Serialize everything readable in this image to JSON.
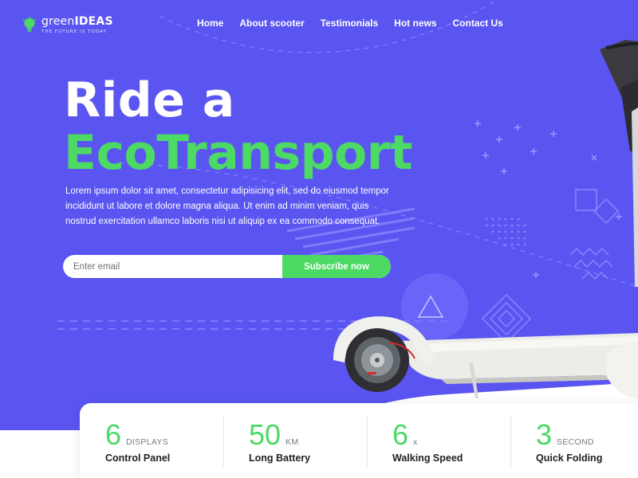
{
  "brand": {
    "name_part1": "green",
    "name_part2": "IDEAS",
    "tagline": "THE FUTURE IS TODAY"
  },
  "nav": {
    "items": [
      {
        "label": "Home"
      },
      {
        "label": "About scooter"
      },
      {
        "label": "Testimonials"
      },
      {
        "label": "Hot news"
      },
      {
        "label": "Contact Us"
      }
    ]
  },
  "hero": {
    "title_line1": "Ride a",
    "title_line2": "EcoTransport",
    "lead": "Lorem ipsum dolor sit amet, consectetur adipisicing elit, sed do eiusmod tempor incididunt ut labore et dolore magna aliqua. Ut enim ad minim veniam, quis nostrud exercitation ullamco laboris nisi ut aliquip ex ea commodo consequat."
  },
  "subscribe": {
    "placeholder": "Enter email",
    "button_label": "Subscribe now"
  },
  "stats": [
    {
      "value": "6",
      "unit": "DISPLAYS",
      "label": "Control Panel"
    },
    {
      "value": "50",
      "unit": "KM",
      "label": "Long Battery"
    },
    {
      "value": "6",
      "unit": "X",
      "label": "Walking Speed"
    },
    {
      "value": "3",
      "unit": "SECOND",
      "label": "Quick Folding"
    }
  ],
  "colors": {
    "primary": "#5a55f0",
    "accent_green": "#4cd964",
    "white": "#ffffff"
  },
  "icons": {
    "logo": "lightbulb-icon"
  }
}
